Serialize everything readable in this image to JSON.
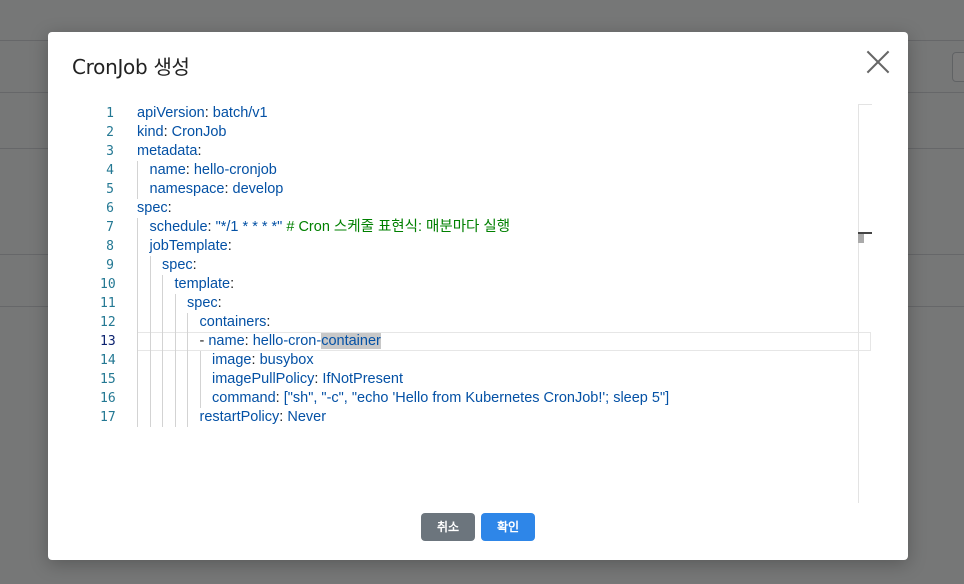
{
  "modal": {
    "title": "CronJob 생성",
    "cancel_label": "취소",
    "confirm_label": "확인"
  },
  "editor": {
    "line_numbers": [
      "1",
      "2",
      "3",
      "4",
      "5",
      "6",
      "7",
      "8",
      "9",
      "10",
      "11",
      "12",
      "13",
      "14",
      "15",
      "16",
      "17"
    ],
    "current_line": 13,
    "lines": [
      {
        "indent": 0,
        "key": "apiVersion",
        "value": "batch/v1"
      },
      {
        "indent": 0,
        "key": "kind",
        "value": "CronJob"
      },
      {
        "indent": 0,
        "key": "metadata",
        "value": ""
      },
      {
        "indent": 1,
        "key": "name",
        "value": "hello-cronjob"
      },
      {
        "indent": 1,
        "key": "namespace",
        "value": "develop"
      },
      {
        "indent": 0,
        "key": "spec",
        "value": ""
      },
      {
        "indent": 1,
        "key": "schedule",
        "value": "\"*/1 * * * *\"",
        "comment": "# Cron 스케줄 표현식: 매분마다 실행"
      },
      {
        "indent": 1,
        "key": "jobTemplate",
        "value": ""
      },
      {
        "indent": 2,
        "key": "spec",
        "value": ""
      },
      {
        "indent": 3,
        "key": "template",
        "value": ""
      },
      {
        "indent": 4,
        "key": "spec",
        "value": ""
      },
      {
        "indent": 5,
        "key": "containers",
        "value": ""
      },
      {
        "indent": 5,
        "dash": true,
        "key": "name",
        "value_plain": "hello-cron-",
        "value_hl": "container"
      },
      {
        "indent": 6,
        "key": "image",
        "value": "busybox"
      },
      {
        "indent": 6,
        "key": "imagePullPolicy",
        "value": "IfNotPresent"
      },
      {
        "indent": 6,
        "key": "command",
        "value": "[\"sh\", \"-c\", \"echo 'Hello from Kubernetes CronJob!'; sleep 5\"]"
      },
      {
        "indent": 5,
        "key": "restartPolicy",
        "value": "Never"
      }
    ]
  },
  "colors": {
    "key": "#0451a5",
    "comment": "#008000",
    "line_number": "#237893",
    "confirm_button": "#2e86e8",
    "cancel_button": "#6c757d"
  }
}
